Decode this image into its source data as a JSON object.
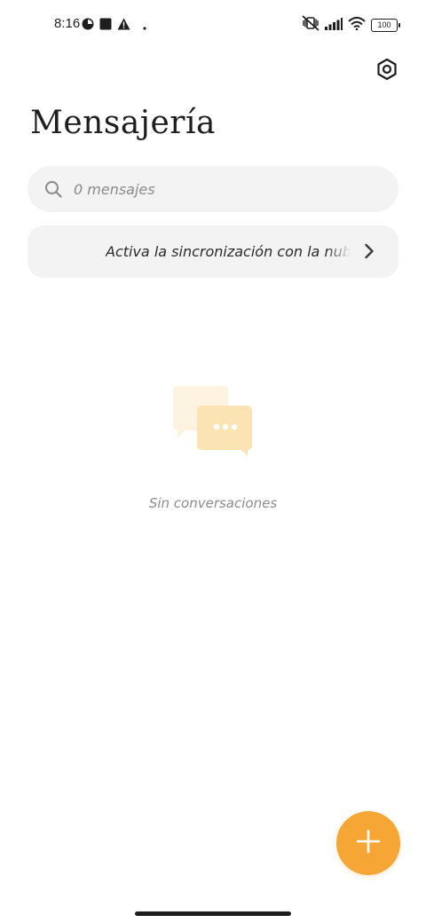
{
  "status_bar": {
    "time": "8:16",
    "battery": "100",
    "left_icons": [
      "vpn-icon",
      "square-icon",
      "warning-icon",
      "dot-icon"
    ],
    "right_icons": [
      "mute-vibrate-icon",
      "signal-icon",
      "wifi-icon",
      "battery-icon"
    ]
  },
  "header": {
    "title": "Mensajería",
    "settings_icon": "gear-icon"
  },
  "search": {
    "placeholder": "0 mensajes",
    "icon": "search-icon"
  },
  "sync_banner": {
    "label": "Activa la sincronización con la nube",
    "icon": "chevron-right-icon"
  },
  "empty_state": {
    "label": "Sin conversaciones",
    "icon": "chat-bubbles-icon"
  },
  "fab": {
    "icon": "plus-icon",
    "color": "#f5a634"
  }
}
